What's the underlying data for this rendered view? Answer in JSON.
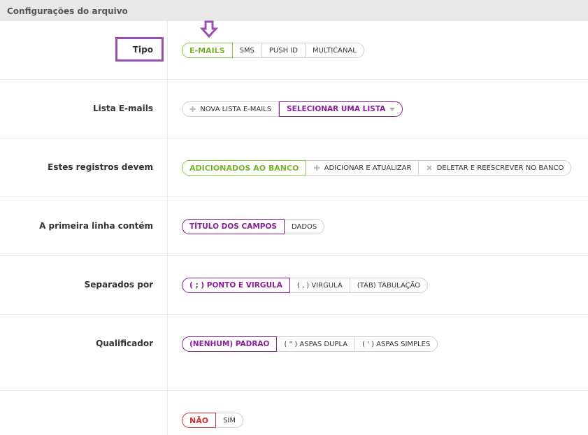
{
  "header": {
    "title": "Configurações do arquivo"
  },
  "rows": {
    "tipo": {
      "label": "Tipo",
      "options": [
        "E-MAILS",
        "SMS",
        "PUSH ID",
        "MULTICANAL"
      ]
    },
    "lista": {
      "label": "Lista E-mails",
      "new_list": "NOVA LISTA E-MAILS",
      "select_list": "SELECIONAR UMA LISTA"
    },
    "registros": {
      "label": "Estes registros devem",
      "options": [
        "ADICIONADOS AO BANCO",
        "ADICIONAR E ATUALIZAR",
        "DELETAR E REESCREVER NO BANCO"
      ]
    },
    "primeira_linha": {
      "label": "A primeira linha contém",
      "options": [
        "TÍTULO DOS CAMPOS",
        "DADOS"
      ]
    },
    "separados": {
      "label": "Separados por",
      "options": [
        "( ; ) PONTO E VIRGULA",
        "( , ) VIRGULA",
        "(TAB) TABULAÇÃO"
      ]
    },
    "qualificador": {
      "label": "Qualificador",
      "options": [
        "(NENHUM) PADRAO",
        "( \" ) ASPAS DUPLA",
        "( ' ) ASPAS SIMPLES"
      ]
    },
    "last": {
      "label": "",
      "options": [
        "NÃO",
        "SIM"
      ]
    }
  },
  "colors": {
    "green": "#8cc63f",
    "purple": "#8a1f9c",
    "red": "#d32f2f",
    "annotation": "#9a4fb0"
  },
  "icons": {
    "add": "plus-icon",
    "delete": "x-icon",
    "dropdown": "caret-down-icon",
    "annotation_arrow": "arrow-down-icon"
  }
}
